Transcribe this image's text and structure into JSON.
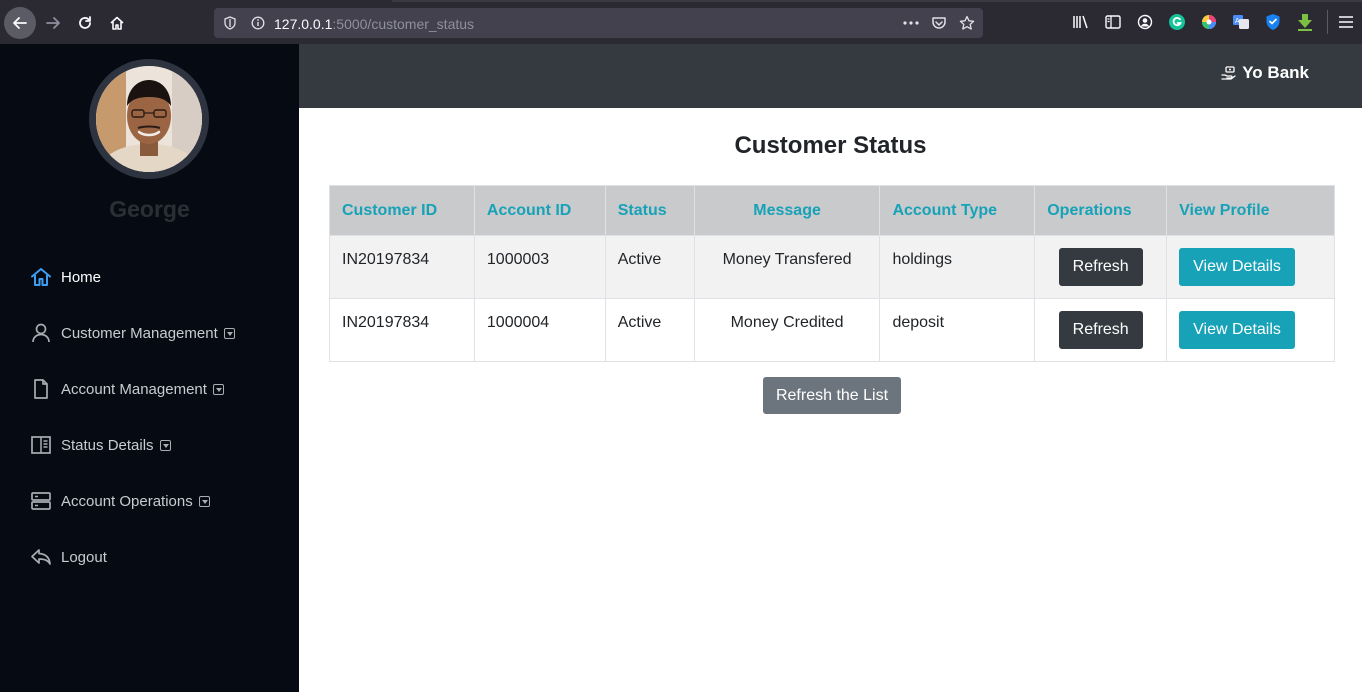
{
  "browser": {
    "url_host": "127.0.0.1",
    "url_rest": ":5000/customer_status",
    "icons": [
      "back-icon",
      "forward-icon",
      "reload-icon",
      "home-icon",
      "shield-icon",
      "info-icon",
      "more-icon",
      "pocket-icon",
      "star-icon",
      "library-icon",
      "sidebar-icon",
      "account-icon",
      "grammarly-icon",
      "colorpicker-icon",
      "translate-icon",
      "bitwarden-icon",
      "download-icon",
      "menu-icon"
    ]
  },
  "sidebar": {
    "user_name": "George",
    "items": [
      {
        "label": "Home",
        "icon": "home-icon",
        "active": true,
        "has_caret": false
      },
      {
        "label": "Customer Management",
        "icon": "user-icon",
        "active": false,
        "has_caret": true
      },
      {
        "label": "Account Management",
        "icon": "file-icon",
        "active": false,
        "has_caret": true
      },
      {
        "label": "Status Details",
        "icon": "columns-icon",
        "active": false,
        "has_caret": true
      },
      {
        "label": "Account Operations",
        "icon": "server-icon",
        "active": false,
        "has_caret": true
      },
      {
        "label": "Logout",
        "icon": "reply-icon",
        "active": false,
        "has_caret": false
      }
    ]
  },
  "header": {
    "brand": "Yo Bank"
  },
  "main": {
    "title": "Customer Status",
    "columns": [
      "Customer ID",
      "Account ID",
      "Status",
      "Message",
      "Account Type",
      "Operations",
      "View Profile"
    ],
    "rows": [
      {
        "customer_id": "IN20197834",
        "account_id": "1000003",
        "status": "Active",
        "message": "Money Transfered",
        "account_type": "holdings",
        "operation_label": "Refresh",
        "view_label": "View Details"
      },
      {
        "customer_id": "IN20197834",
        "account_id": "1000004",
        "status": "Active",
        "message": "Money Credited",
        "account_type": "deposit",
        "operation_label": "Refresh",
        "view_label": "View Details"
      }
    ],
    "refresh_list_label": "Refresh the List"
  },
  "colors": {
    "accent": "#17a2b8",
    "sidebar_bg": "#060b13",
    "topbar_bg": "#343a40",
    "active_icon": "#3d9df3"
  }
}
